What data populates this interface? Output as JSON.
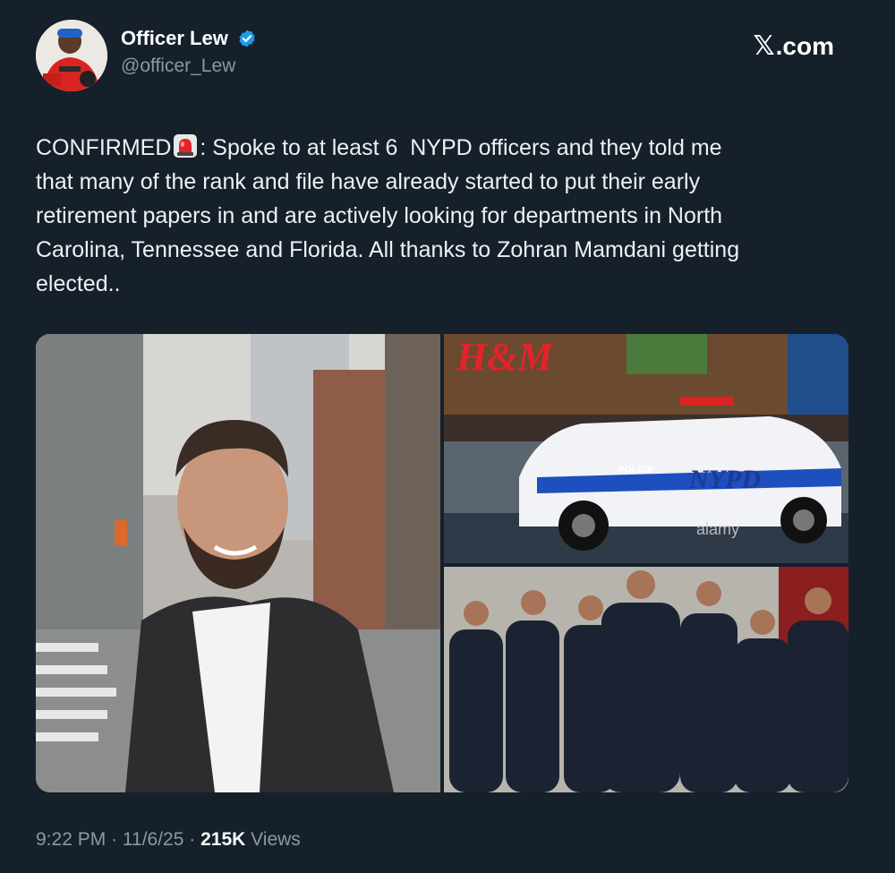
{
  "post": {
    "author": {
      "display_name": "Officer Lew",
      "handle": "@officer_Lew",
      "verified": true,
      "avatar_icon": "profile-avatar"
    },
    "site_label": ".com",
    "site_icon": "x-logo-icon",
    "text_before_emoji": "CONFIRMED",
    "emoji_icon": "siren-emoji",
    "text_after_emoji": ": Spoke to at least 6  NYPD officers and they told me\nthat many of the rank and file have already started to put their early\nretirement papers in and are actively looking for departments in North\nCarolina, Tennessee and Florida. All thanks to Zohran Mamdani getting\nelected..",
    "media": {
      "images": [
        {
          "description_icon": "portrait-photo-icon"
        },
        {
          "watermark": "alamy",
          "car_label": "NYPD",
          "car_stripe_text": "POLICE",
          "store_sign": "H&M"
        },
        {
          "description_icon": "group-of-officers-photo-icon"
        }
      ]
    },
    "meta": {
      "time": "9:22 PM",
      "separator": "·",
      "date": "11/6/25",
      "views_count": "215K",
      "views_label": "Views"
    }
  },
  "colors": {
    "background": "#15202b",
    "text": "#e7e9ea",
    "secondary_text": "#8b98a5",
    "verified_blue": "#1d9bf0"
  }
}
